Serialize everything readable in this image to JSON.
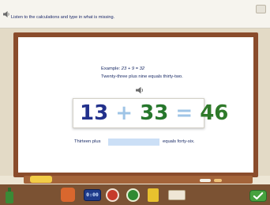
{
  "instruction": {
    "text": "Listen to the calculations and type in what is missing."
  },
  "example": {
    "label": "Example:",
    "equation": "23 + 9 = 32",
    "words": "Twenty-three plus nine equals thirty-two."
  },
  "equation": {
    "operand1": "13",
    "operator": "+",
    "operand2": "33",
    "equals": "=",
    "result": "46"
  },
  "answer": {
    "prefix": "Thirteen plus",
    "value": "",
    "suffix": "equals forty-six."
  },
  "toolbar": {
    "timer_label": "0:00"
  },
  "icons": {
    "speaker": "speaker-icon",
    "check": "check-icon",
    "star": "star-icon"
  },
  "colors": {
    "operand1": "#22318c",
    "operand2": "#26772c",
    "result": "#2f7a2a",
    "operator": "#9fc4e6",
    "input_bg": "#cbdff6",
    "board_frame": "#8a4c2c"
  }
}
